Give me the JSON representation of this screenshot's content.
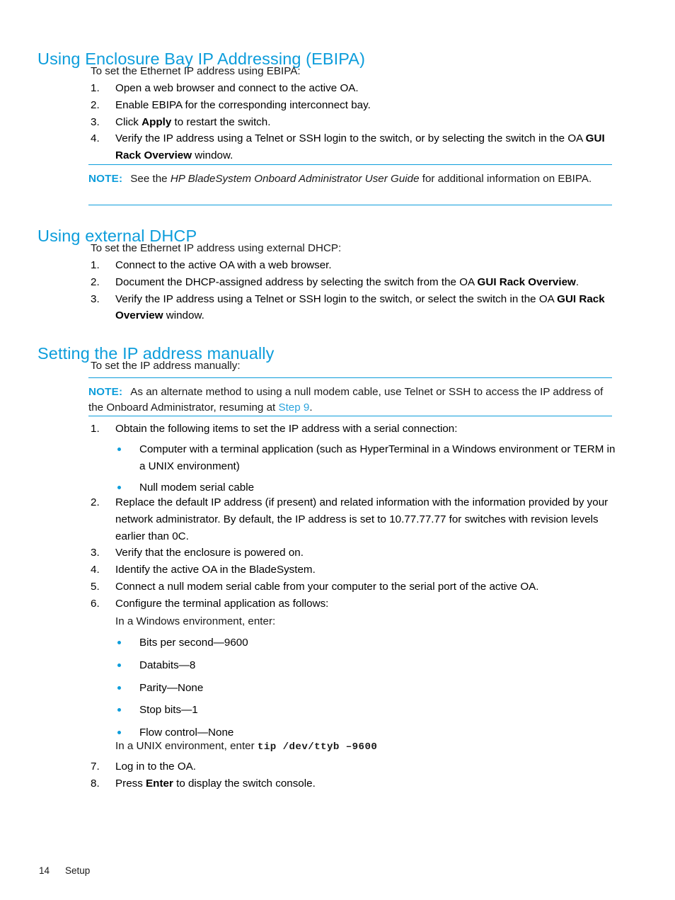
{
  "sections": [
    {
      "heading": "Using Enclosure Bay IP Addressing (EBIPA)",
      "intro": "To set the Ethernet IP address using EBIPA:",
      "steps": [
        {
          "num": "1.",
          "pre": "Open a web browser and connect to the active OA.",
          "bold": "",
          "post": ""
        },
        {
          "num": "2.",
          "pre": "Enable EBIPA for the corresponding interconnect bay.",
          "bold": "",
          "post": ""
        },
        {
          "num": "3.",
          "pre": "Click ",
          "bold": "Apply",
          "post": " to restart the switch."
        },
        {
          "num": "4.",
          "pre": "Verify the IP address using a Telnet or SSH login to the switch, or by selecting the switch in the OA ",
          "bold": "GUI Rack Overview",
          "post": " window."
        }
      ],
      "note": {
        "label": "NOTE:",
        "pre": "See the ",
        "italic": "HP BladeSystem Onboard Administrator User Guide",
        "post": " for additional information on EBIPA."
      }
    },
    {
      "heading": "Using external DHCP",
      "intro": "To set the Ethernet IP address using external DHCP:",
      "steps": [
        {
          "num": "1.",
          "pre": "Connect to the active OA with a web browser.",
          "bold": "",
          "post": ""
        },
        {
          "num": "2.",
          "pre": "Document the DHCP-assigned address by selecting the switch from the OA ",
          "bold": "GUI Rack Overview",
          "post": "."
        },
        {
          "num": "3.",
          "pre": "Verify the IP address using a Telnet or SSH login to the switch, or select the switch in the OA ",
          "bold": "GUI Rack Overview",
          "post": " window."
        }
      ]
    },
    {
      "heading": "Setting the IP address manually",
      "intro": "To set the IP address manually:",
      "note": {
        "label": "NOTE:",
        "pre": "As an alternate method to using a null modem cable, use Telnet or SSH to access the IP address of the Onboard Administrator, resuming at ",
        "link": "Step 9",
        "post": "."
      },
      "steps": [
        {
          "num": "1.",
          "pre": "Obtain the following items to set the IP address with a serial connection:",
          "bold": "",
          "post": ""
        },
        {
          "num": "2.",
          "pre": "Replace the default IP address (if present) and related information with the information provided by your network administrator. By default, the IP address is set to 10.77.77.77 for switches with revision levels earlier than 0C.",
          "bold": "",
          "post": ""
        },
        {
          "num": "3.",
          "pre": "Verify that the enclosure is powered on.",
          "bold": "",
          "post": ""
        },
        {
          "num": "4.",
          "pre": "Identify the active OA in the BladeSystem.",
          "bold": "",
          "post": ""
        },
        {
          "num": "5.",
          "pre": "Connect a null modem serial cable from your computer to the serial port of the active OA.",
          "bold": "",
          "post": ""
        },
        {
          "num": "6.",
          "pre": "Configure the terminal application as follows:",
          "bold": "",
          "post": ""
        },
        {
          "num": "7.",
          "pre": "Log in to the OA.",
          "bold": "",
          "post": ""
        },
        {
          "num": "8.",
          "pre": "Press ",
          "bold": "Enter",
          "post": " to display the switch console."
        }
      ],
      "requirement_bullets": [
        "Computer with a terminal application (such as HyperTerminal in a Windows environment or TERM in a UNIX environment)",
        "Null modem serial cable"
      ],
      "windows_intro": "In a Windows environment, enter:",
      "terminal_settings": [
        "Bits per second—9600",
        "Databits—8",
        "Parity—None",
        "Stop bits—1",
        "Flow control—None"
      ],
      "unix_line_pre": "In a UNIX environment, enter ",
      "unix_command": "tip /dev/ttyb –9600"
    }
  ],
  "footer": {
    "page_number": "14",
    "chapter": "Setup"
  },
  "colors": {
    "heading": "#0d9ddb",
    "note_label": "#0d9ddb",
    "note_rule": "#0d9ddb",
    "link": "#2aa3dd",
    "bullet": "#0d9ddb",
    "text": "#1a1a1a"
  }
}
